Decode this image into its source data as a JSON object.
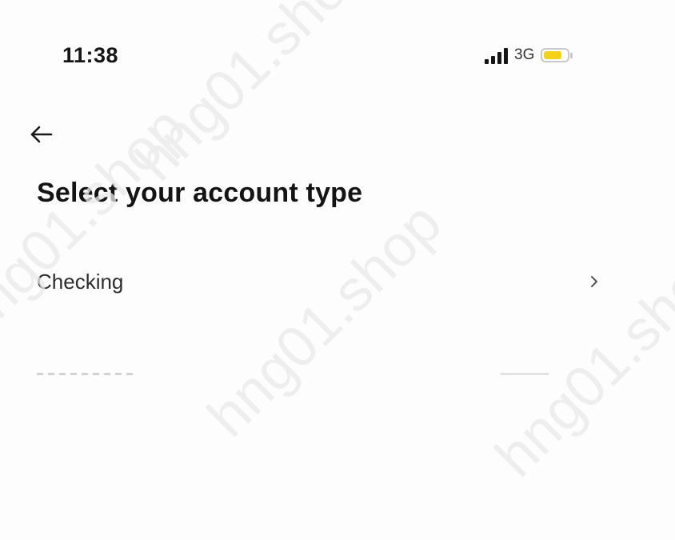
{
  "status_bar": {
    "time": "11:38",
    "network": "3G",
    "icons": [
      "signal-icon",
      "battery-icon"
    ],
    "battery_color": "#f5d21a"
  },
  "header": {
    "back_icon": "arrow-left-icon"
  },
  "page": {
    "title": "Select your account type"
  },
  "account_types": [
    {
      "label": "Checking",
      "icon": "chevron-right-icon"
    }
  ],
  "watermark": {
    "text": "hng01.shop"
  }
}
